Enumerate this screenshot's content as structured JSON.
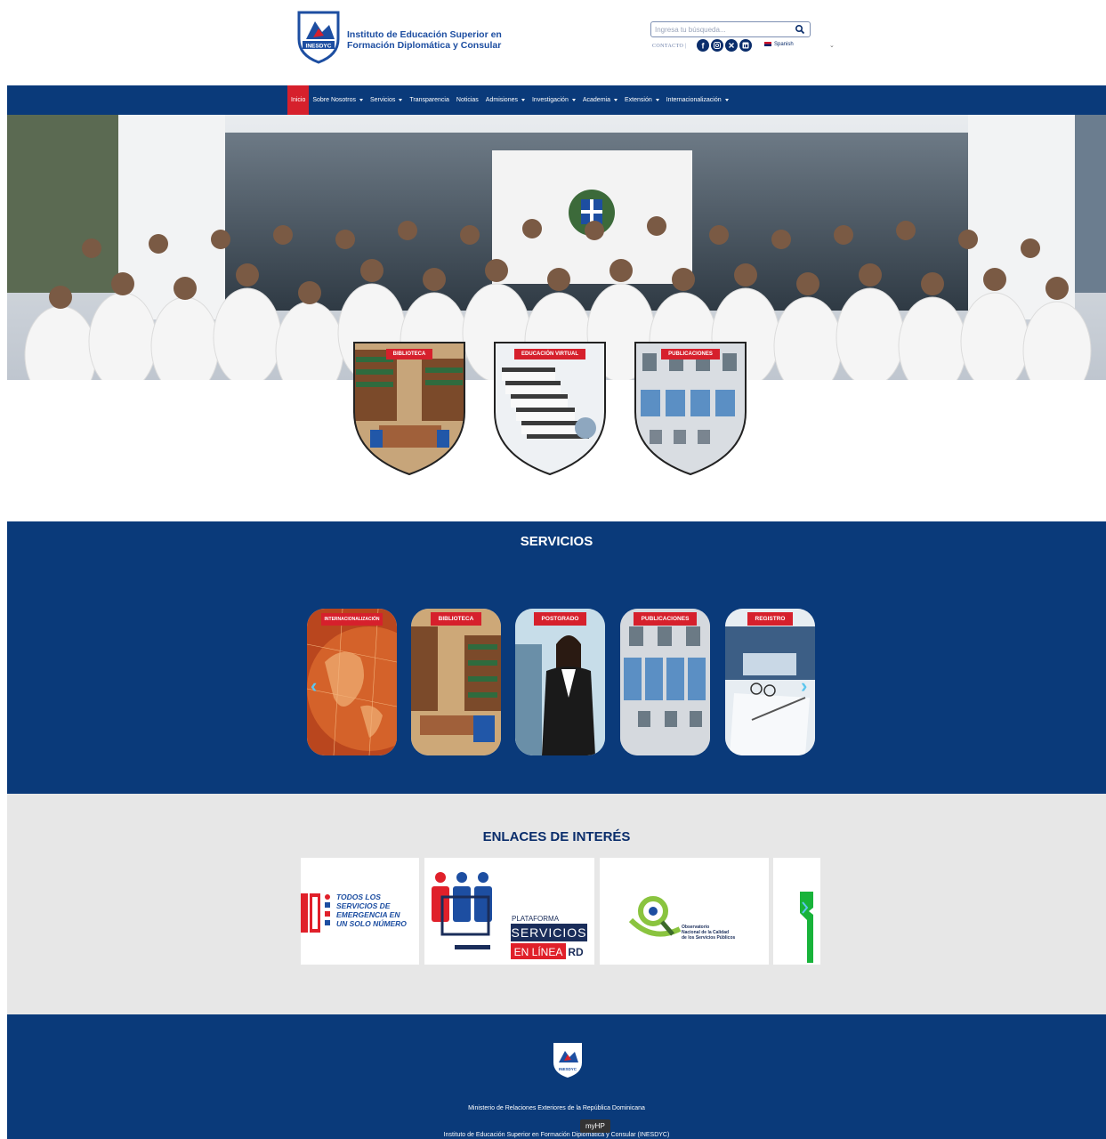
{
  "header": {
    "logo_text_line1": "Instituto de Educación Superior en",
    "logo_text_line2": "Formación Diplomática y Consular",
    "logo_acronym": "INESDYC",
    "search_placeholder": "Ingresa tu búsqueda...",
    "contact_label": "CONTACTO |",
    "social_icons": [
      "facebook-icon",
      "instagram-icon",
      "x-icon",
      "linkedin-icon"
    ],
    "language": "Spanish"
  },
  "nav": {
    "items": [
      {
        "label": "Inicio",
        "active": true,
        "dropdown": false
      },
      {
        "label": "Sobre Nosotros",
        "dropdown": true
      },
      {
        "label": "Servicios",
        "dropdown": true
      },
      {
        "label": "Transparencia",
        "dropdown": false
      },
      {
        "label": "Noticias",
        "dropdown": false
      },
      {
        "label": "Admisiones",
        "dropdown": true
      },
      {
        "label": "Investigación",
        "dropdown": true
      },
      {
        "label": "Academia",
        "dropdown": true
      },
      {
        "label": "Extensión",
        "dropdown": true
      },
      {
        "label": "Internacionalización",
        "dropdown": true
      }
    ]
  },
  "hero_cards": [
    {
      "label": "BIBLIOTECA"
    },
    {
      "label": "EDUCACIÓN VIRTUAL"
    },
    {
      "label": "PUBLICACIONES"
    }
  ],
  "servicios": {
    "title": "SERVICIOS",
    "cards": [
      {
        "label": "INTERNACIONALIZACIÓN"
      },
      {
        "label": "BIBLIOTECA"
      },
      {
        "label": "POSTGRADO"
      },
      {
        "label": "PUBLICACIONES"
      },
      {
        "label": "REGISTRO"
      }
    ],
    "prev_arrow": "‹",
    "next_arrow": "›"
  },
  "enlaces": {
    "title": "ENLACES DE INTERÉS",
    "card1_text": [
      "TODOS LOS",
      "SERVICIOS DE",
      "EMERGENCIA EN",
      "UN SOLO NÚMERO"
    ],
    "card2_small": "PLATAFORMA",
    "card2_big1": "SERVICIOS",
    "card2_big2": "EN LÍNEA",
    "card2_rd": "RD",
    "card3_text": [
      "Observatorio",
      "Nacional de la Calidad",
      "de los Servicios Públicos"
    ]
  },
  "footer": {
    "line1": "Ministerio de Relaciones Exteriores de la República Dominicana",
    "line2": "Instituto de Educación Superior en Formación Diplomática y Consular (INESDYC)",
    "logo_acronym": "INESDYC"
  },
  "tooltip": "myHP",
  "colors": {
    "brand_navy": "#0a3a7a",
    "accent_red": "#d6202c",
    "light_gray": "#e7e7e7"
  }
}
